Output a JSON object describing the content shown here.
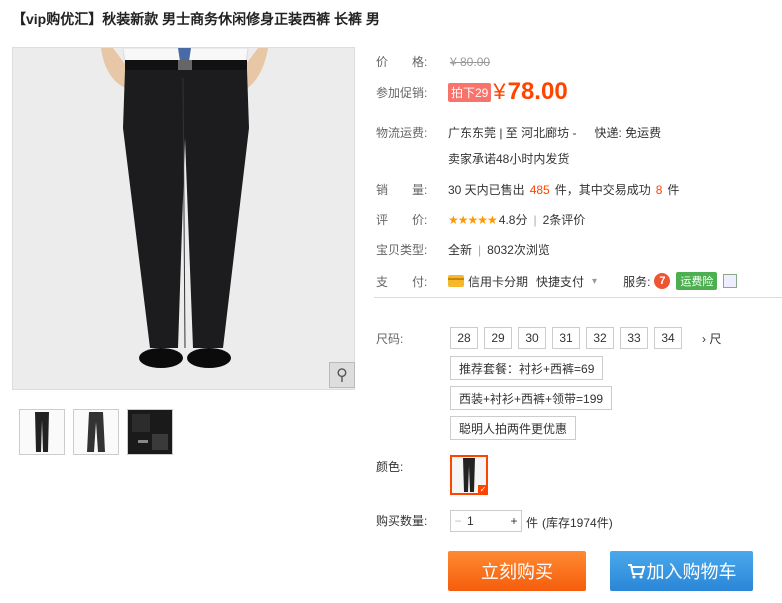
{
  "title": "【vip购优汇】秋装新款 男士商务休闲修身正装西裤 长裤 男",
  "price": {
    "label": "价　　格:",
    "original": "¥ 80.00"
  },
  "promo": {
    "label": "参加促销:",
    "badge": "拍下29",
    "currency": "¥",
    "price": "78.00"
  },
  "logistics": {
    "label": "物流运费:",
    "route": "广东东莞 | 至  河北廊坊 -",
    "express": "快递: 免运费",
    "promise": "卖家承诺48小时内发货"
  },
  "sales": {
    "label": "销　　量:",
    "prefix": "30 天内已售出",
    "count": "485",
    "mid": "件，其中交易成功",
    "success": "8",
    "suffix": "件"
  },
  "rating": {
    "label": "评　　价:",
    "stars": "★★★★★",
    "score": "4.8分",
    "reviews": "2条评价"
  },
  "type": {
    "label": "宝贝类型:",
    "condition": "全新",
    "views": "8032次浏览"
  },
  "payment": {
    "label": "支　　付:",
    "credit": "信用卡分期",
    "quick": "快捷支付",
    "service_label": "服务:",
    "seven": "7",
    "insurance": "运费险"
  },
  "sizes": {
    "label": "尺码:",
    "options": [
      "28",
      "29",
      "30",
      "31",
      "32",
      "33",
      "34"
    ],
    "more": "› 尺"
  },
  "sets": [
    "推荐套餐：衬衫+西裤=69",
    "西装+衬衫+西裤+领带=199",
    "聪明人拍两件更优惠"
  ],
  "color": {
    "label": "颜色:"
  },
  "quantity": {
    "label": "购买数量:",
    "value": "1",
    "unit": "件",
    "stock": "(库存1974件)"
  },
  "buttons": {
    "buy": "立刻购买",
    "cart": "加入购物车"
  },
  "icons": {
    "zoom": "magnifier-icon",
    "cart": "cart-icon"
  }
}
